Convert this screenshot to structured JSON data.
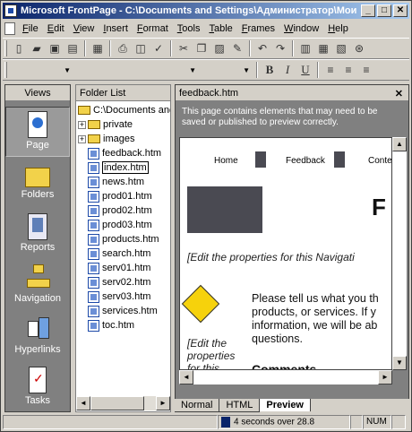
{
  "window": {
    "title": "Microsoft FrontPage - C:\\Documents and Settings\\Администратор\\Мои д...",
    "min_btn": "_",
    "max_btn": "□",
    "close_btn": "✕"
  },
  "menu": [
    "File",
    "Edit",
    "View",
    "Insert",
    "Format",
    "Tools",
    "Table",
    "Frames",
    "Window",
    "Help"
  ],
  "toolbar_combo_arrow": "▼",
  "format_buttons": {
    "bold": "B",
    "italic": "I",
    "underline": "U"
  },
  "views": {
    "header": "Views",
    "items": [
      {
        "label": "Page",
        "icon": "page-icon",
        "active": true
      },
      {
        "label": "Folders",
        "icon": "folder-icon"
      },
      {
        "label": "Reports",
        "icon": "reports-icon"
      },
      {
        "label": "Navigation",
        "icon": "navigation-icon"
      },
      {
        "label": "Hyperlinks",
        "icon": "hyperlinks-icon"
      },
      {
        "label": "Tasks",
        "icon": "tasks-icon"
      }
    ]
  },
  "folder_list": {
    "header": "Folder List",
    "root": "C:\\Documents and S",
    "folders": [
      "private",
      "images"
    ],
    "files": [
      "feedback.htm",
      "index.htm",
      "news.htm",
      "prod01.htm",
      "prod02.htm",
      "prod03.htm",
      "products.htm",
      "search.htm",
      "serv01.htm",
      "serv02.htm",
      "serv03.htm",
      "services.htm",
      "toc.htm"
    ],
    "selected": "index.htm",
    "expand_glyph": "+"
  },
  "editor": {
    "tab_title": "feedback.htm",
    "close": "✕",
    "info_message": "This page contains elements that may need to be saved or published to preview correctly.",
    "nav_links": [
      "Home",
      "Feedback",
      "Conte"
    ],
    "heading_letter": "F",
    "nav_edit_props": "[Edit the properties for this Navigati",
    "side_edit_props": [
      "[Edit the",
      "properties",
      "for this"
    ],
    "body_text": "Please tell us what you th products, or services. If y information, we will be ab questions.",
    "comments_heading": "Comments"
  },
  "view_tabs": [
    {
      "label": "Normal"
    },
    {
      "label": "HTML"
    },
    {
      "label": "Preview",
      "active": true
    }
  ],
  "status": {
    "download_time": "4 seconds over 28.8",
    "num": "NUM"
  },
  "scroll": {
    "left": "◄",
    "right": "►",
    "up": "▲",
    "down": "▼"
  }
}
